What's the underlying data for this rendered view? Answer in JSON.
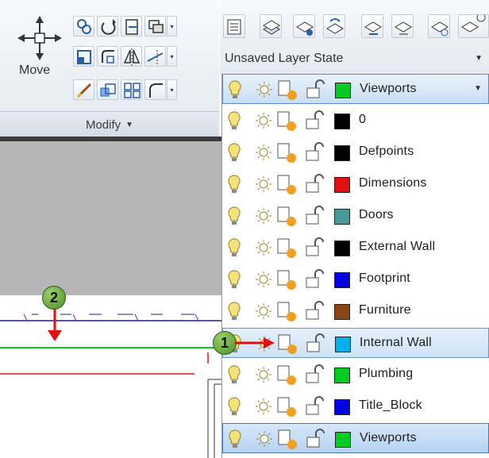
{
  "modify_panel": {
    "move_label": "Move",
    "footer_label": "Modify",
    "footer_arrow": "▼"
  },
  "layer_state": {
    "value": "Unsaved Layer State",
    "arrow": "▼"
  },
  "current_layer": {
    "name": "Viewports",
    "color": "#00cc22",
    "arrow": "▼"
  },
  "layers": [
    {
      "name": "0",
      "color": "#000000"
    },
    {
      "name": "Defpoints",
      "color": "#000000"
    },
    {
      "name": "Dimensions",
      "color": "#e01010"
    },
    {
      "name": "Doors",
      "color": "#4a9a9a"
    },
    {
      "name": "External Wall",
      "color": "#000000"
    },
    {
      "name": "Footprint",
      "color": "#0000e0"
    },
    {
      "name": "Furniture",
      "color": "#8b4513"
    },
    {
      "name": "Internal Wall",
      "color": "#00b0f0"
    },
    {
      "name": "Plumbing",
      "color": "#00cc22"
    },
    {
      "name": "Title_Block",
      "color": "#0000e0"
    },
    {
      "name": "Viewports",
      "color": "#00cc22"
    }
  ],
  "callouts": {
    "one": "1",
    "two": "2"
  },
  "icons": {
    "on_off": "lightbulb-icon",
    "freeze": "sun-icon",
    "viewport_freeze": "viewport-freeze-icon",
    "lock": "padlock-open-icon"
  }
}
